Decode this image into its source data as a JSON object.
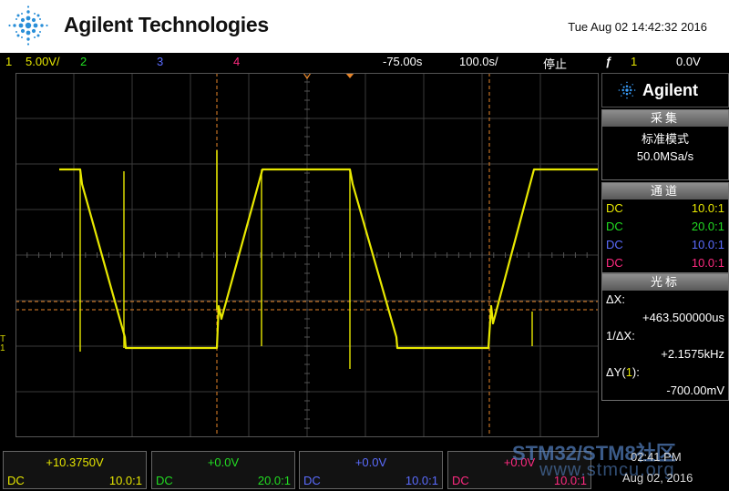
{
  "header": {
    "brand": "Agilent Technologies",
    "datetime": "Tue Aug 02 14:42:32 2016"
  },
  "status": {
    "ch1_num": "1",
    "ch1_scale": "5.00V/",
    "ch2_num": "2",
    "ch3_num": "3",
    "ch4_num": "4",
    "time_offset": "-75.00s",
    "time_scale": "100.0s/",
    "run_state": "停止",
    "trigger_icon": "ƒ",
    "trigger_ch": "1",
    "trigger_level": "0.0V"
  },
  "panel": {
    "brand": "Agilent",
    "acquire": {
      "title": "采集",
      "mode": "标准模式",
      "rate": "50.0MSa/s"
    },
    "channels": {
      "title": "通道",
      "rows": [
        {
          "coupling": "DC",
          "probe": "10.0:1",
          "color": "#e6e600"
        },
        {
          "coupling": "DC",
          "probe": "20.0:1",
          "color": "#22dd22"
        },
        {
          "coupling": "DC",
          "probe": "10.0:1",
          "color": "#5b6cff"
        },
        {
          "coupling": "DC",
          "probe": "10.0:1",
          "color": "#ff2a80"
        }
      ]
    },
    "cursors": {
      "title": "光标",
      "dx_label": "ΔX:",
      "dx_value": "+463.500000us",
      "inv_dx_label": "1/ΔX:",
      "inv_dx_value": "+2.1575kHz",
      "dy_label_pre": "ΔY(",
      "dy_ch": "1",
      "dy_label_post": "):",
      "dy_value": "-700.00mV"
    }
  },
  "bottom": {
    "channels": [
      {
        "value": "+10.3750V",
        "coupling": "DC",
        "probe": "10.0:1",
        "color": "#e6e600"
      },
      {
        "value": "+0.0V",
        "coupling": "DC",
        "probe": "20.0:1",
        "color": "#22dd22"
      },
      {
        "value": "+0.0V",
        "coupling": "DC",
        "probe": "10.0:1",
        "color": "#5b6cff"
      },
      {
        "value": "+0.0V",
        "coupling": "DC",
        "probe": "10.0:1",
        "color": "#ff2a80"
      }
    ],
    "time": "02:41 PM",
    "date": "Aug 02, 2016",
    "watermark1": "STM32/STM8社区",
    "watermark2": "www.stmcu.org"
  },
  "trace": {
    "color": "#e8e800",
    "cursor_color": "#e8862a",
    "trigger_marker": "T",
    "ground_marker": "1"
  }
}
